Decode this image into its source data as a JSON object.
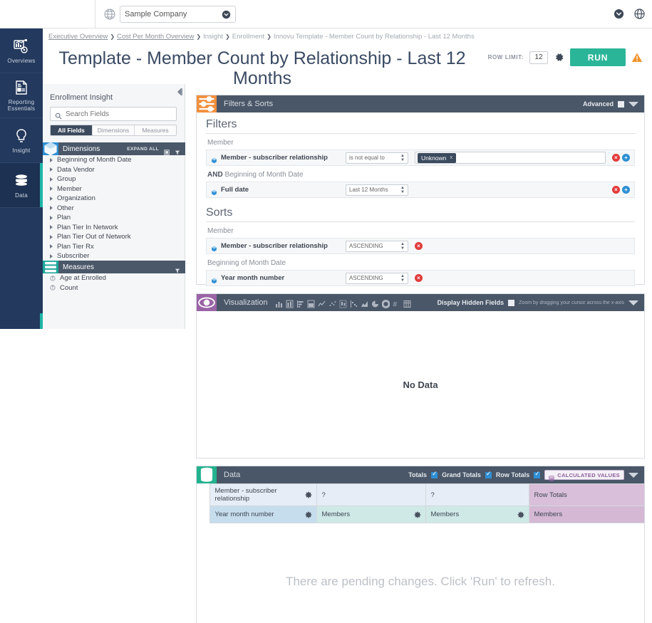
{
  "topbar": {
    "globe_icon": "globe-icon",
    "company_value": "Sample Company",
    "company_caret": "chevron-down-circle-icon",
    "right_icons": [
      "chevron-down-circle-icon",
      "help-globe-icon"
    ]
  },
  "leftnav": {
    "items": [
      {
        "label": "Overviews",
        "icon": "overviews-chart-icon",
        "selected": false
      },
      {
        "label": "Reporting Essentials",
        "icon": "report-document-icon",
        "selected": false
      },
      {
        "label": "Insight",
        "icon": "lightbulb-icon",
        "selected": false
      },
      {
        "label": "Data",
        "icon": "database-icon",
        "selected": true
      }
    ]
  },
  "breadcrumb": {
    "items": [
      {
        "label": "Executive Overview",
        "link": true
      },
      {
        "label": "Cost Per Month Overview",
        "link": true
      },
      {
        "label": "Insight",
        "link": false
      },
      {
        "label": "Enrollment",
        "link": false
      },
      {
        "label": "Innovu Template - Member Count by Relationship - Last 12 Months",
        "link": false
      }
    ],
    "separator": "❯"
  },
  "header": {
    "title": "Template - Member Count by Relationship - Last 12 Months",
    "row_limit_label": "ROW LIMIT:",
    "row_limit_value": "12",
    "gear_icon": "gear-icon",
    "run_label": "RUN",
    "warning_icon": "warning-triangle-icon"
  },
  "fieldbar": {
    "collapse_icon": "collapse-panel-icon",
    "title": "Enrollment Insight",
    "search_placeholder": "Search Fields",
    "search_value": "",
    "search_icon": "search-icon",
    "tabs": [
      {
        "label": "All Fields",
        "active": true
      },
      {
        "label": "Dimensions",
        "active": false
      },
      {
        "label": "Measures",
        "active": false
      }
    ],
    "dimensions_group": {
      "title": "Dimensions",
      "icon": "cube-icon",
      "expand_all": "EXPAND ALL",
      "collapse_icon": "collapse-square-icon",
      "filter_icon": "funnel-icon",
      "fields": [
        "Beginning of Month Date",
        "Data Vendor",
        "Group",
        "Member",
        "Organization",
        "Other",
        "Plan",
        "Plan Tier In Network",
        "Plan Tier Out of Network",
        "Plan Tier Rx",
        "Subscriber"
      ]
    },
    "measures_group": {
      "title": "Measures",
      "icon": "measures-icon",
      "filter_icon": "funnel-icon",
      "fields": [
        "Age at Enrolled",
        "Count"
      ]
    }
  },
  "filters_panel": {
    "icon": "filters-sliders-icon",
    "title": "Filters & Sorts",
    "advanced_label": "Advanced",
    "advanced_checked": false,
    "caret_icon": "caret-down-icon",
    "filters_title": "Filters",
    "sorts_title": "Sorts",
    "filters": [
      {
        "group_prefix": "",
        "group_label": "Member",
        "field_icon": "cube-icon",
        "field": "Member - subscriber relationship",
        "operator": "is not equal to",
        "tokens": [
          "Unknown"
        ],
        "remove_icon": "remove-circle-icon",
        "add_icon": "add-circle-icon"
      },
      {
        "group_prefix": "AND",
        "group_label": "Beginning of Month Date",
        "field_icon": "cube-icon",
        "field": "Full date",
        "operator": "Last 12 Months",
        "tokens": [],
        "remove_icon": "remove-circle-icon",
        "add_icon": "add-circle-icon"
      }
    ],
    "sorts": [
      {
        "group_label": "Member",
        "field_icon": "cube-icon",
        "field": "Member - subscriber relationship",
        "direction": "ASCENDING",
        "remove_icon": "remove-circle-icon"
      },
      {
        "group_label": "Beginning of Month Date",
        "field_icon": "cube-icon",
        "field": "Year month number",
        "direction": "ASCENDING",
        "remove_icon": "remove-circle-icon"
      }
    ]
  },
  "viz_panel": {
    "icon": "eye-icon",
    "title": "Visualization",
    "chart_icons": [
      "bar-chart-icon",
      "stacked-bar-icon",
      "horizontal-bar-icon",
      "grouped-bar-icon",
      "line-chart-icon",
      "scatter-plot-icon",
      "box-plot-icon",
      "waterfall-icon",
      "area-chart-icon",
      "pie-chart-icon",
      "donut-chart-icon",
      "number-icon",
      "table-icon"
    ],
    "display_hidden_label": "Display Hidden Fields",
    "display_hidden_checked": false,
    "zoom_hint": "Zoom by dragging your cursor across the x-axis",
    "caret_icon": "caret-down-icon",
    "empty_message": "No Data"
  },
  "data_panel": {
    "icon": "database-icon",
    "title": "Data",
    "toggles": [
      {
        "label": "Totals",
        "checked": true
      },
      {
        "label": "Grand Totals",
        "checked": true
      },
      {
        "label": "Row Totals",
        "checked": true
      }
    ],
    "calculated_values_label": "CALCULATED VALUES",
    "calculated_values_icon": "calculator-icon",
    "caret_icon": "caret-down-icon",
    "table": {
      "header_rows": [
        [
          {
            "text": "Member - subscriber relationship",
            "style": "rowhdr1",
            "gear": true
          },
          {
            "text": "?",
            "style": "rowhdr1",
            "gear": false
          },
          {
            "text": "?",
            "style": "rowhdr1",
            "gear": false
          },
          {
            "text": "Row Totals",
            "style": "cell-mauve",
            "gear": false
          }
        ],
        [
          {
            "text": "Year month number",
            "style": "rowhdr2",
            "gear": true
          },
          {
            "text": "Members",
            "style": "cell-teal",
            "gear": true
          },
          {
            "text": "Members",
            "style": "cell-teal",
            "gear": true
          },
          {
            "text": "Members",
            "style": "cell-mauve2",
            "gear": false
          }
        ]
      ],
      "pending_message": "There are pending changes. Click 'Run' to refresh."
    }
  }
}
